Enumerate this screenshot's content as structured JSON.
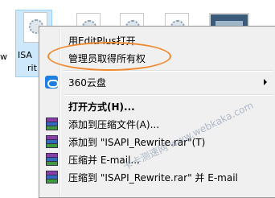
{
  "desktop": {
    "left_label": "w",
    "selected_file_label_line1": "ISA",
    "selected_file_label_line2": "rit"
  },
  "menu": {
    "items": [
      {
        "label": "用EditPlus打开"
      },
      {
        "label": "管理员取得所有权"
      },
      {
        "label": "360云盘",
        "icon": "cloud-360-icon",
        "submenu": true
      },
      {
        "label": "打开方式(H)..."
      },
      {
        "label": "添加到压缩文件(A)...",
        "icon": "rar-icon"
      },
      {
        "label": "添加到 \"ISAPI_Rewrite.rar\"(T)",
        "icon": "rar-icon"
      },
      {
        "label": "压缩并 E-mail...",
        "icon": "rar-icon"
      },
      {
        "label": "压缩到 \"ISAPI_Rewrite.rar\" 并 E-mail",
        "icon": "rar-icon"
      }
    ]
  },
  "watermark": "卡卡测速网 www.webkaka.com",
  "colors": {
    "menu_bg": "#f0f0f0",
    "highlight": "#f08a30",
    "selection": "#cde8fb"
  }
}
